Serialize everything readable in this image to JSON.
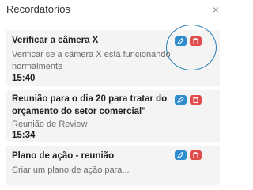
{
  "header": {
    "title": "Recordatorios",
    "close_label": "×"
  },
  "reminders": [
    {
      "title": "Verificar a câmera X",
      "description_lines": [
        "Verificar se a câmera X está funcionando",
        "normalmente"
      ],
      "time": "15:40"
    },
    {
      "title_lines": [
        "Reunião para o dia 20 para tratar do",
        "orçamento do setor comercial\""
      ],
      "description": "Reunião de Review",
      "time": "15:34"
    },
    {
      "title": "Plano de ação - reunião",
      "description": "Criar um plano de ação para..."
    }
  ],
  "colors": {
    "edit_button": "#2e8ccf",
    "delete_button": "#e04c4c",
    "highlight_ring": "#2a7db3"
  }
}
